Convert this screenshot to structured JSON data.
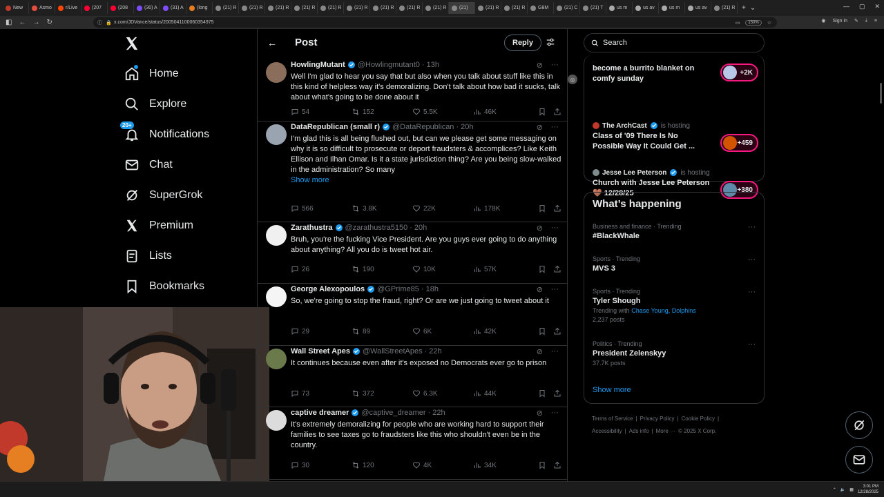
{
  "browser": {
    "tabs": [
      {
        "label": "New",
        "color": "#c0392b"
      },
      {
        "label": "Asmo",
        "color": "#e74c3c"
      },
      {
        "label": "r/Live",
        "color": "#ff4500"
      },
      {
        "label": "(207",
        "color": "#ff0033"
      },
      {
        "label": "(208",
        "color": "#ff0033"
      },
      {
        "label": "(30) A",
        "color": "#7c4dff"
      },
      {
        "label": "(31) A",
        "color": "#7c4dff"
      },
      {
        "label": "(long",
        "color": "#e67e22"
      },
      {
        "label": "(21) R",
        "color": "#888888"
      },
      {
        "label": "(21) R",
        "color": "#888888"
      },
      {
        "label": "(21) R",
        "color": "#888888"
      },
      {
        "label": "(21) R",
        "color": "#888888"
      },
      {
        "label": "(21) R",
        "color": "#888888"
      },
      {
        "label": "(21) R",
        "color": "#888888"
      },
      {
        "label": "(21) R",
        "color": "#888888"
      },
      {
        "label": "(21) R",
        "color": "#888888"
      },
      {
        "label": "(21) R",
        "color": "#888888"
      },
      {
        "label": "(21)",
        "color": "#888888",
        "active": true
      },
      {
        "label": "(21) R",
        "color": "#888888"
      },
      {
        "label": "(21) R",
        "color": "#888888"
      },
      {
        "label": "G8M",
        "color": "#888888"
      },
      {
        "label": "(21) C",
        "color": "#888888"
      },
      {
        "label": "(21) T",
        "color": "#888888"
      },
      {
        "label": "us m",
        "color": "#aaaaaa"
      },
      {
        "label": "us av",
        "color": "#aaaaaa"
      },
      {
        "label": "us m",
        "color": "#aaaaaa"
      },
      {
        "label": "us av",
        "color": "#aaaaaa"
      },
      {
        "label": "(21) R",
        "color": "#888888"
      }
    ],
    "url": "x.com/JDVance/status/2005041100060354975",
    "zoom": "150%",
    "signin_label": "Sign in"
  },
  "taskbar": {
    "time": "3:01 PM",
    "date": "12/28/2025"
  },
  "nav": {
    "items": [
      {
        "label": "Home"
      },
      {
        "label": "Explore"
      },
      {
        "label": "Notifications",
        "badge": "20+"
      },
      {
        "label": "Chat"
      },
      {
        "label": "SuperGrok"
      },
      {
        "label": "Premium"
      },
      {
        "label": "Lists"
      },
      {
        "label": "Bookmarks"
      }
    ]
  },
  "header": {
    "title": "Post",
    "reply_label": "Reply"
  },
  "replies": [
    {
      "name": "HowlingMutant",
      "handle": "@Howlingmutant0",
      "time": "· 13h",
      "text": "Well I'm glad to hear you say that but also when you talk about stuff like this in this kind of helpless way it's demoralizing.  Don't talk about how bad it sucks, talk about what's going to be done about it",
      "comments": "54",
      "reposts": "152",
      "likes": "5.5K",
      "views": "46K"
    },
    {
      "name": "DataRepublican (small r)",
      "handle": "@DataRepublican",
      "time": "· 20h",
      "text": "I'm glad this is all being flushed out, but can we please get some messaging on why it is so difficult to prosecute or deport fraudsters & accomplices? Like Keith Ellison and Ilhan Omar. Is it a state jurisdiction thing? Are you being slow-walked in the administration? So many",
      "show_more": "Show more",
      "comments": "566",
      "reposts": "3.8K",
      "likes": "22K",
      "views": "178K"
    },
    {
      "name": "Zarathustra",
      "handle": "@zarathustra5150",
      "time": "· 20h",
      "text": "Bruh, you're the fucking Vice President. Are you guys ever going to do anything about anything? All you do is tweet hot air.",
      "comments": "26",
      "reposts": "190",
      "likes": "10K",
      "views": "57K"
    },
    {
      "name": "George Alexopoulos",
      "handle": "@GPrime85",
      "time": "· 18h",
      "text": "So, we're going to stop the fraud, right? Or are we just going to tweet about it",
      "comments": "29",
      "reposts": "89",
      "likes": "6K",
      "views": "42K"
    },
    {
      "name": "Wall Street Apes",
      "handle": "@WallStreetApes",
      "time": "· 22h",
      "text": "It continues because even after it's exposed no Democrats ever go to prison",
      "comments": "73",
      "reposts": "372",
      "likes": "6.3K",
      "views": "44K"
    },
    {
      "name": "captive dreamer",
      "handle": "@captive_dreamer",
      "time": "· 22h",
      "text": "It's extremely demoralizing for people who are working hard to support their families to see taxes go to fraudsters like this who shouldn't even be in the country.",
      "comments": "30",
      "reposts": "120",
      "likes": "4K",
      "views": "34K"
    }
  ],
  "search": {
    "placeholder": "Search"
  },
  "spaces": [
    {
      "host": "",
      "hosting": "is hosting",
      "title": "become a burrito blanket on comfy sunday",
      "count": "+2K"
    },
    {
      "host": "The ArchCast",
      "hosting": "is hosting",
      "title": "Class of '09 There Is No Possible Way It Could Get ...",
      "count": "+459"
    },
    {
      "host": "Jesse Lee Peterson",
      "hosting": "is hosting",
      "title": "Church with Jesse Lee Peterson 🤎 12/28/25",
      "count": "+380"
    }
  ],
  "happening": {
    "title": "What’s happening",
    "trends": [
      {
        "meta": "Business and finance · Trending",
        "name": "#BlackWhale"
      },
      {
        "meta": "Sports · Trending",
        "name": "MVS 3"
      },
      {
        "meta": "Sports · Trending",
        "name": "Tyler Shough",
        "sub_prefix": "Trending with",
        "sub_links": "Chase Young, Dolphins",
        "posts": "2,237 posts"
      },
      {
        "meta": "Politics · Trending",
        "name": "President Zelenskyy",
        "posts": "37.7K posts"
      }
    ],
    "show_more": "Show more"
  },
  "footer": {
    "line1": [
      "Terms of Service",
      "|",
      "Privacy Policy",
      "|",
      "Cookie Policy",
      "|"
    ],
    "line2": [
      "Accessibility",
      "|",
      "Ads info",
      "|",
      "More ···",
      "© 2025 X Corp."
    ]
  }
}
